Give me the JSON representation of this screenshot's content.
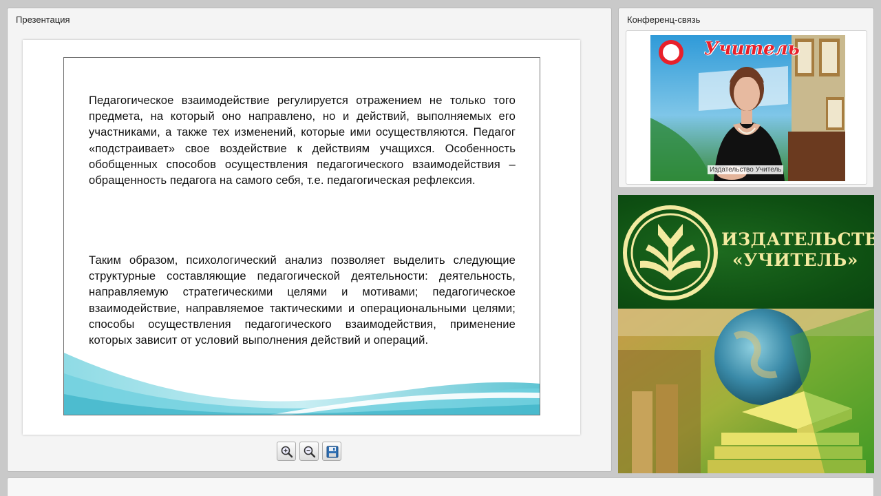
{
  "presentation": {
    "title": "Презентация",
    "slide": {
      "paragraph1": "Педагогическое взаимодействие регулируется отражением не только того предмета, на который оно направлено, но и действий, выполняемых его участниками, а также тех изменений, которые ими осуществляются. Педагог «подстраивает» свое воздействие к действиям учащихся. Особенность обобщенных способов осуществления педагогического взаимодействия – обращенность педагога на самого себя, т.е. педагогическая рефлексия.",
      "paragraph2": "Таким образом, психологический анализ позволяет выделить следующие структурные составляющие педагогической деятельности: деятельность, направляемую стратегическими целями и мотивами; педагогическое взаимодействие, направляемое тактическими и операциональными целями; способы осуществления педагогического взаимодействия, применение которых зависит от условий выполнения действий и операций."
    },
    "toolbar": {
      "zoom_in_icon": "zoom-in-icon",
      "zoom_out_icon": "zoom-out-icon",
      "save_icon": "floppy-disk-icon"
    }
  },
  "conference": {
    "title": "Конференц-связь",
    "video_label": "Издательство Учитель",
    "backdrop_brand": "Учитель"
  },
  "banner": {
    "line1": "ИЗДАТЕЛЬСТВО",
    "line2": "«УЧИТЕЛЬ»"
  },
  "colors": {
    "banner_green": "#0e4f12",
    "banner_text": "#f3eaa0",
    "slide_wave": "#2fb4c8"
  }
}
